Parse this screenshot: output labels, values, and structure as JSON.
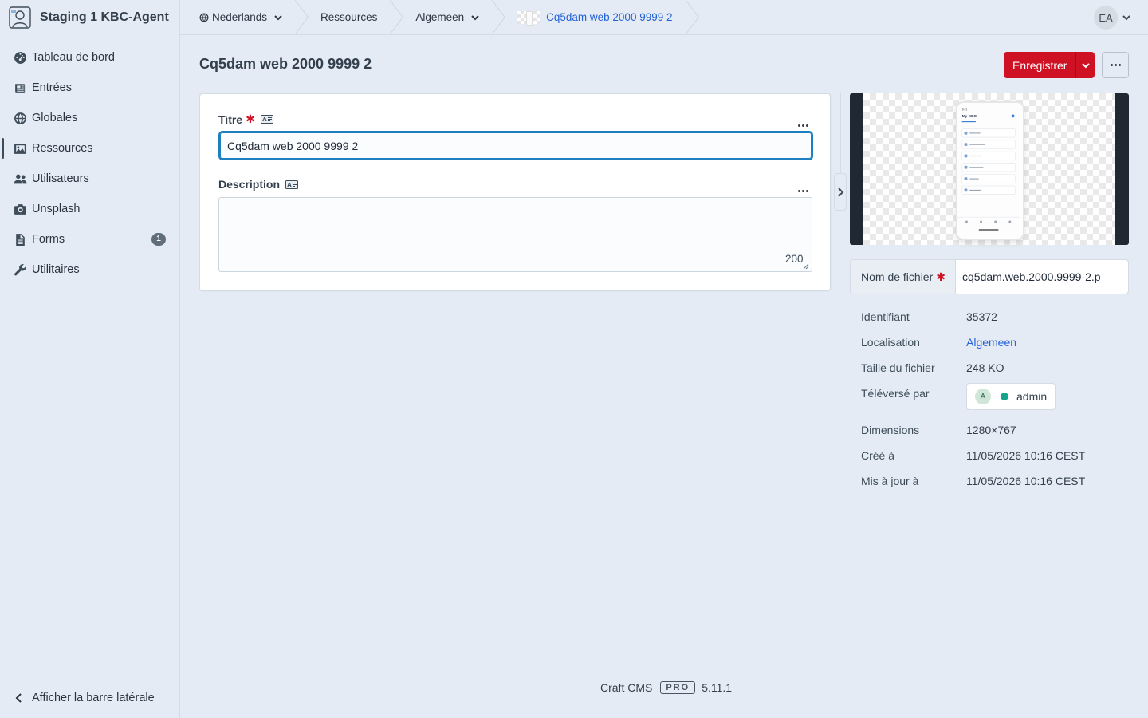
{
  "app": {
    "site_name": "Staging 1 KBC-Agent"
  },
  "sidebar": {
    "items": [
      {
        "label": "Tableau de bord",
        "icon": "dashboard-gauge-icon"
      },
      {
        "label": "Entrées",
        "icon": "newspaper-icon"
      },
      {
        "label": "Globales",
        "icon": "globe-icon"
      },
      {
        "label": "Ressources",
        "icon": "image-icon",
        "active": true
      },
      {
        "label": "Utilisateurs",
        "icon": "users-icon"
      },
      {
        "label": "Unsplash",
        "icon": "camera-icon"
      },
      {
        "label": "Forms",
        "icon": "document-icon",
        "badge": "1"
      },
      {
        "label": "Utilitaires",
        "icon": "wrench-icon"
      }
    ],
    "toggle_label": "Afficher la barre latérale"
  },
  "breadcrumbs": {
    "site": "Nederlands",
    "section": "Ressources",
    "volume": "Algemeen",
    "current": "Cq5dam web 2000 9999 2"
  },
  "user": {
    "initials": "EA"
  },
  "page": {
    "title": "Cq5dam web 2000 9999 2",
    "save_label": "Enregistrer"
  },
  "form": {
    "title_label": "Titre",
    "title_value": "Cq5dam web 2000 9999 2",
    "description_label": "Description",
    "description_value": "",
    "description_remaining": "200"
  },
  "details": {
    "filename_label": "Nom de fichier",
    "filename_value": "cq5dam.web.2000.9999-2.p",
    "meta": [
      {
        "key": "Identifiant",
        "value": "35372"
      },
      {
        "key": "Localisation",
        "value": "Algemeen",
        "link": true
      },
      {
        "key": "Taille du fichier",
        "value": "248 KO"
      },
      {
        "key": "Téléversé par",
        "value": "admin",
        "avatar": "A"
      },
      {
        "key": "Dimensions",
        "value": "1280×767"
      },
      {
        "key": "Créé à",
        "value": "11/05/2026 10:16 CEST"
      },
      {
        "key": "Mis à jour à",
        "value": "11/05/2026 10:16 CEST"
      }
    ]
  },
  "preview": {
    "phone_header": "My KBC"
  },
  "footer": {
    "product": "Craft CMS",
    "edition": "PRO",
    "version": "5.11.1"
  },
  "colors": {
    "accent": "#cf1124",
    "link": "#2563d7",
    "focus": "#1d7fbf",
    "background": "#e4ebf4"
  }
}
